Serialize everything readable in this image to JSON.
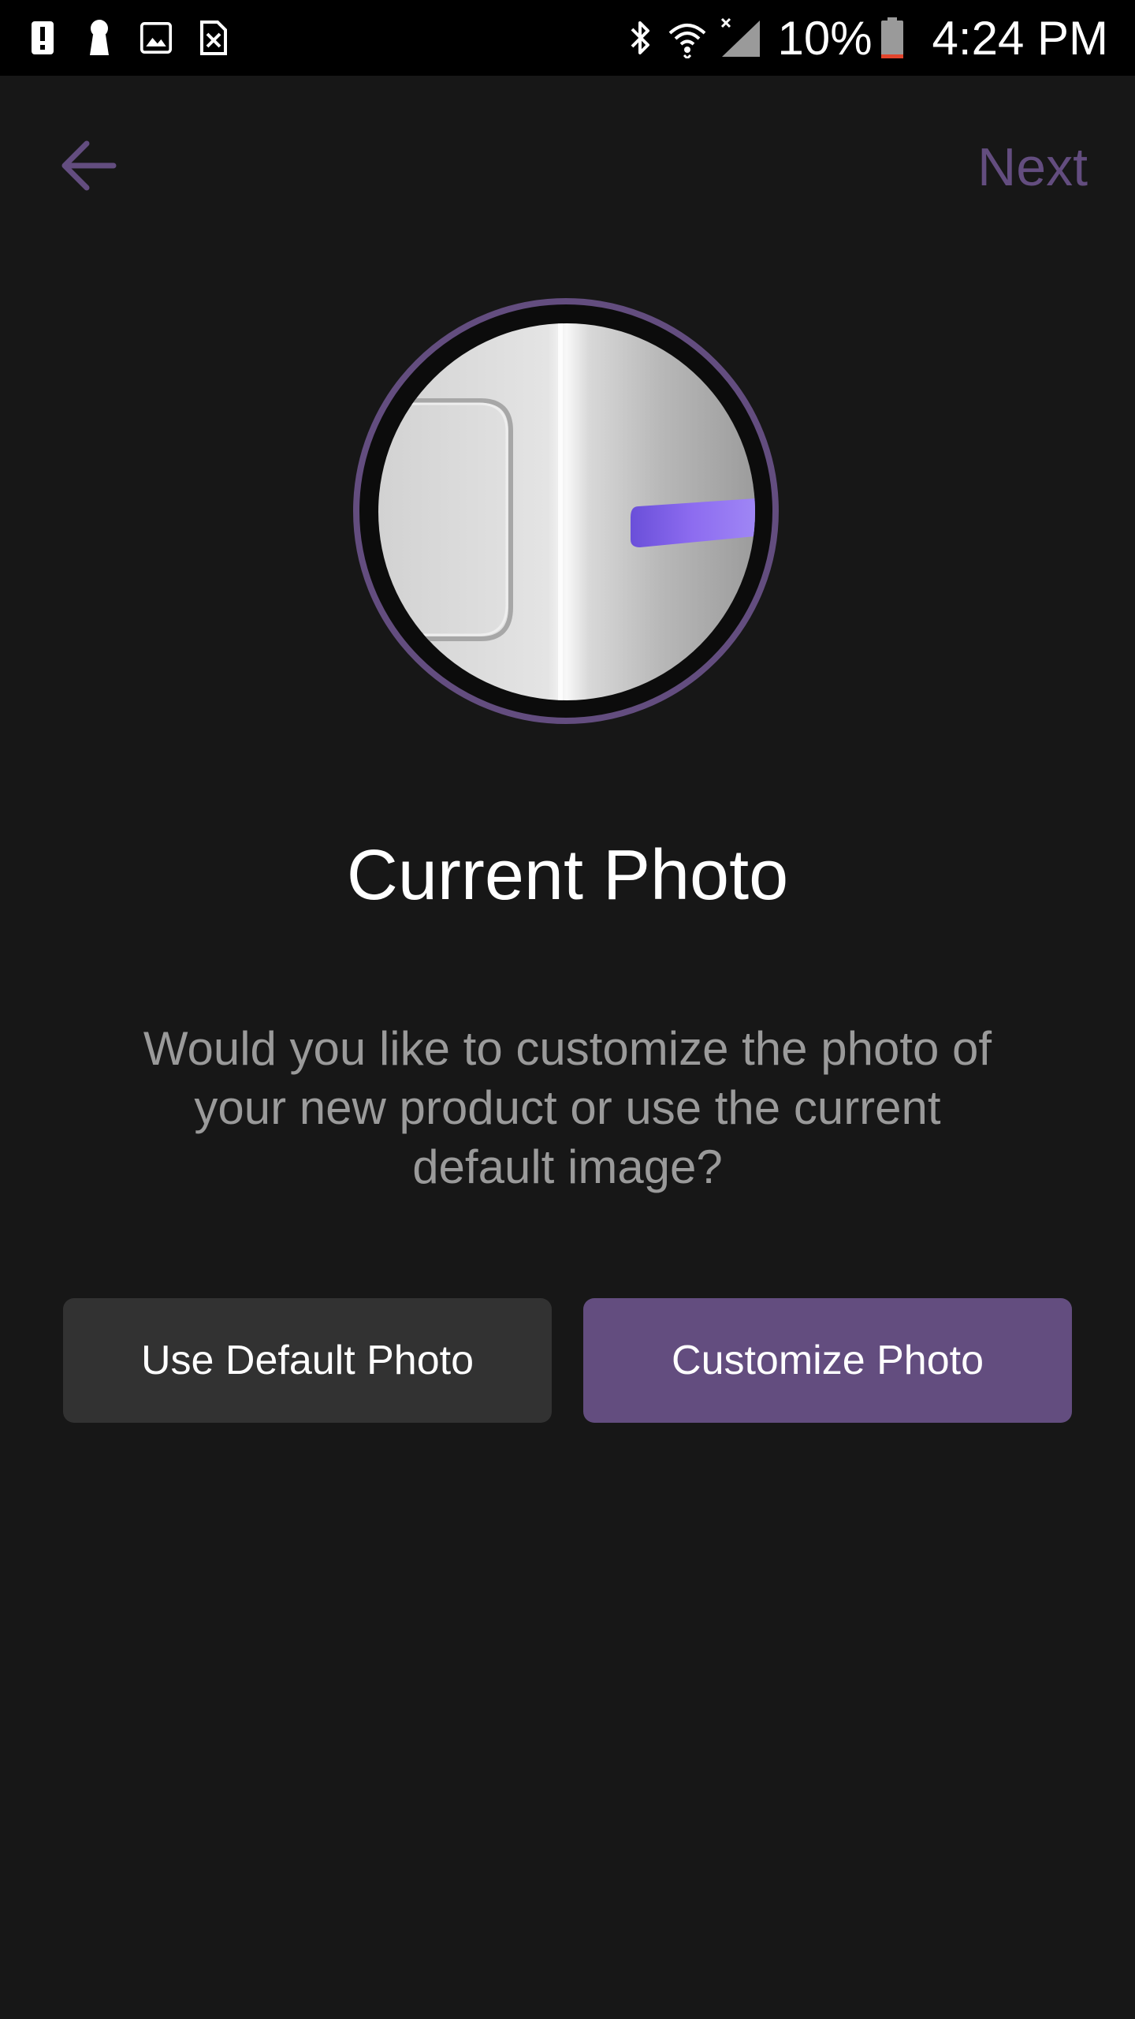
{
  "status_bar": {
    "left_icons": [
      "alert-icon",
      "keyhole-icon",
      "image-icon",
      "close-box-icon"
    ],
    "right_icons": [
      "bluetooth-icon",
      "wifi-icon",
      "signal-icon",
      "battery-icon"
    ],
    "battery_percent": "10%",
    "time": "4:24 PM"
  },
  "app_bar": {
    "back_icon": "arrow-left-icon",
    "next_label": "Next"
  },
  "avatar": {
    "image": "product-photo"
  },
  "content": {
    "title": "Current Photo",
    "description": "Would you like to customize the photo of your new product or use the current default image?"
  },
  "actions": {
    "use_default_label": "Use Default Photo",
    "customize_label": "Customize Photo"
  },
  "colors": {
    "accent": "#634d7f",
    "background": "#171717",
    "secondary_button": "#323232",
    "status_bar": "#000000"
  }
}
